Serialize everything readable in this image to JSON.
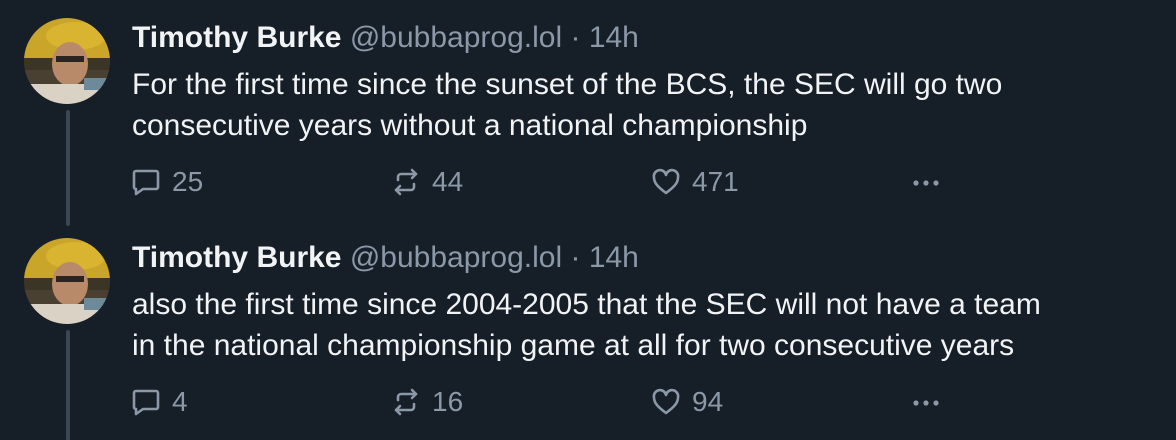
{
  "posts": [
    {
      "author_name": "Timothy Burke",
      "author_handle": "@bubbaprog.lol",
      "separator": "·",
      "timestamp": "14h",
      "text_lines": [
        "For the first time since the sunset of the BCS, the SEC will go two",
        "consecutive years without a national championship"
      ],
      "replies": "25",
      "reposts": "44",
      "likes": "471",
      "icons": {
        "reply": "reply-bubble-icon",
        "repost": "repost-arrows-icon",
        "like": "heart-icon",
        "more": "more-dots-icon"
      }
    },
    {
      "author_name": "Timothy Burke",
      "author_handle": "@bubbaprog.lol",
      "separator": "·",
      "timestamp": "14h",
      "text_lines": [
        "also the first time since 2004-2005 that the SEC will not have a team",
        "in the national championship game at all for two consecutive years"
      ],
      "replies": "4",
      "reposts": "16",
      "likes": "94",
      "icons": {
        "reply": "reply-bubble-icon",
        "repost": "repost-arrows-icon",
        "like": "heart-icon",
        "more": "more-dots-icon"
      }
    }
  ],
  "colors": {
    "background": "#161e27",
    "text": "#f1f3f5",
    "muted": "#8b98a8",
    "thread_line": "#3a4655"
  }
}
